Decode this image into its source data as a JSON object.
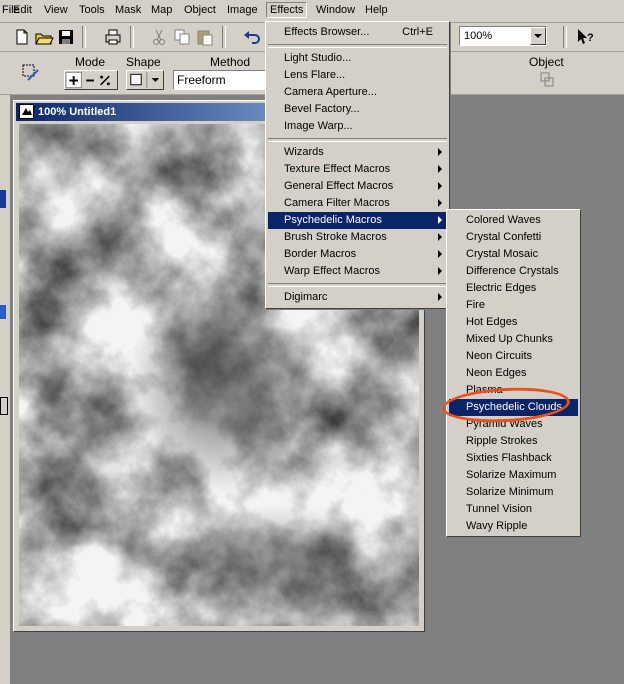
{
  "menubar": {
    "items": [
      "File",
      "Edit",
      "View",
      "Tools",
      "Mask",
      "Map",
      "Object",
      "Image",
      "Effects",
      "Window",
      "Help"
    ]
  },
  "toolbar": {
    "zoom_value": "100%"
  },
  "property_bar": {
    "mode_label": "Mode",
    "shape_label": "Shape",
    "method_label": "Method",
    "method_value": "Freeform",
    "object_label": "Object"
  },
  "document": {
    "title": "100% Untitled1"
  },
  "effects_menu": {
    "items": [
      {
        "label": "Effects Browser...",
        "shortcut": "Ctrl+E"
      },
      {
        "label": "Light Studio..."
      },
      {
        "label": "Lens Flare..."
      },
      {
        "label": "Camera Aperture..."
      },
      {
        "label": "Bevel Factory..."
      },
      {
        "label": "Image Warp..."
      },
      {
        "label": "Wizards"
      },
      {
        "label": "Texture Effect Macros"
      },
      {
        "label": "General Effect Macros"
      },
      {
        "label": "Camera Filter Macros"
      },
      {
        "label": "Psychedelic Macros"
      },
      {
        "label": "Brush Stroke Macros"
      },
      {
        "label": "Border Macros"
      },
      {
        "label": "Warp Effect Macros"
      },
      {
        "label": "Digimarc"
      }
    ]
  },
  "psychedelic_submenu": {
    "items": [
      "Colored Waves",
      "Crystal Confetti",
      "Crystal Mosaic",
      "Difference Crystals",
      "Electric Edges",
      "Fire",
      "Hot Edges",
      "Mixed Up Chunks",
      "Neon Circuits",
      "Neon Edges",
      "Plasma",
      "Psychedelic Clouds",
      "Pyramid Waves",
      "Ripple Strokes",
      "Sixties Flashback",
      "Solarize Maximum",
      "Solarize Minimum",
      "Tunnel Vision",
      "Wavy Ripple"
    ]
  },
  "colors": {
    "highlight": "#0a246a",
    "annotation": "#e8501c"
  }
}
